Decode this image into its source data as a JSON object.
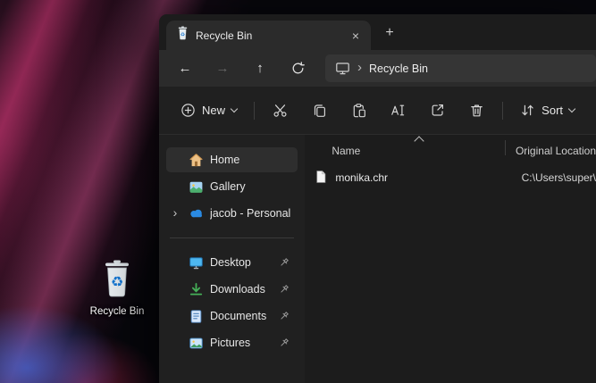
{
  "colors": {
    "selection_gray": "#2e2e2e",
    "accent_desktop_blue": "#4db7f0",
    "onedrive_blue": "#2a8ae2",
    "downloads_green": "#45b058",
    "home_tan": "#ecc186",
    "recycle_symbol_blue": "#1577d4"
  },
  "desktop": {
    "recycle_bin_label": "Recycle Bin"
  },
  "window": {
    "tab": {
      "title": "Recycle Bin",
      "close_glyph": "×",
      "new_tab_glyph": "+"
    },
    "navigation": {
      "back_glyph": "←",
      "forward_glyph": "→",
      "up_glyph": "↑"
    },
    "address_bar": {
      "separator_glyph": "›",
      "location": "Recycle Bin"
    },
    "toolbar": {
      "new_label": "New",
      "sort_label": "Sort"
    },
    "sidebar": {
      "expand_glyph": "›",
      "items": [
        {
          "label": "Home"
        },
        {
          "label": "Gallery"
        },
        {
          "label": "jacob - Personal"
        }
      ],
      "pinned_items": [
        {
          "label": "Desktop"
        },
        {
          "label": "Downloads"
        },
        {
          "label": "Documents"
        },
        {
          "label": "Pictures"
        }
      ]
    },
    "file_list": {
      "columns": [
        {
          "label": "Name"
        },
        {
          "label": "Original Location"
        }
      ],
      "rows": [
        {
          "name": "monika.chr",
          "original_location": "C:\\Users\\super\\"
        }
      ]
    }
  }
}
